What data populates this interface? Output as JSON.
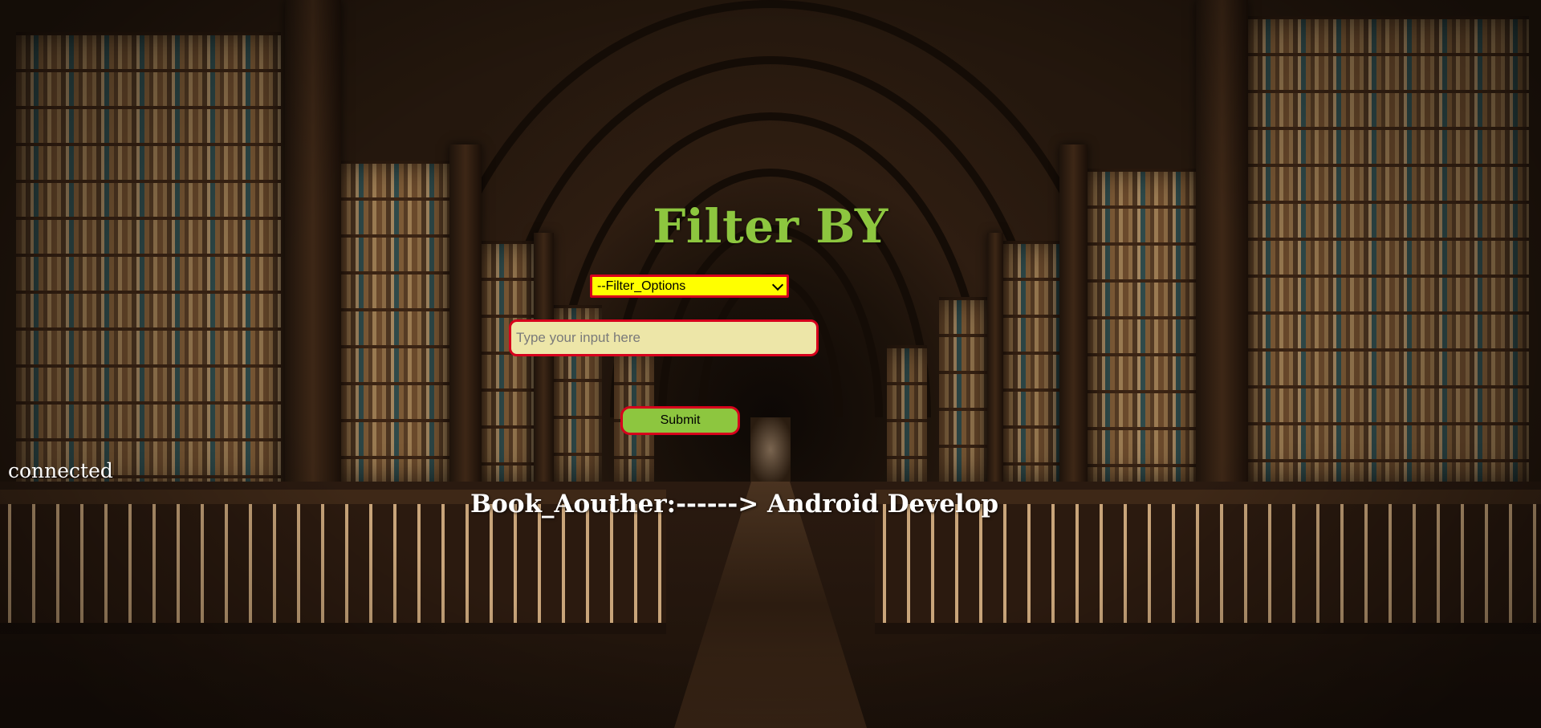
{
  "page": {
    "heading": "Filter BY",
    "status": "connected",
    "result_text": "Book_Aouther:------> Android Develop"
  },
  "filter": {
    "selected_label": "--Filter_Options",
    "select_bg": "#ffff00",
    "border_color": "#d6001c"
  },
  "search": {
    "placeholder": "Type your input here",
    "value": ""
  },
  "form": {
    "submit_label": "Submit",
    "accent": "#8dc63f"
  },
  "icons": {
    "select_arrow": "chevron-down-icon"
  }
}
